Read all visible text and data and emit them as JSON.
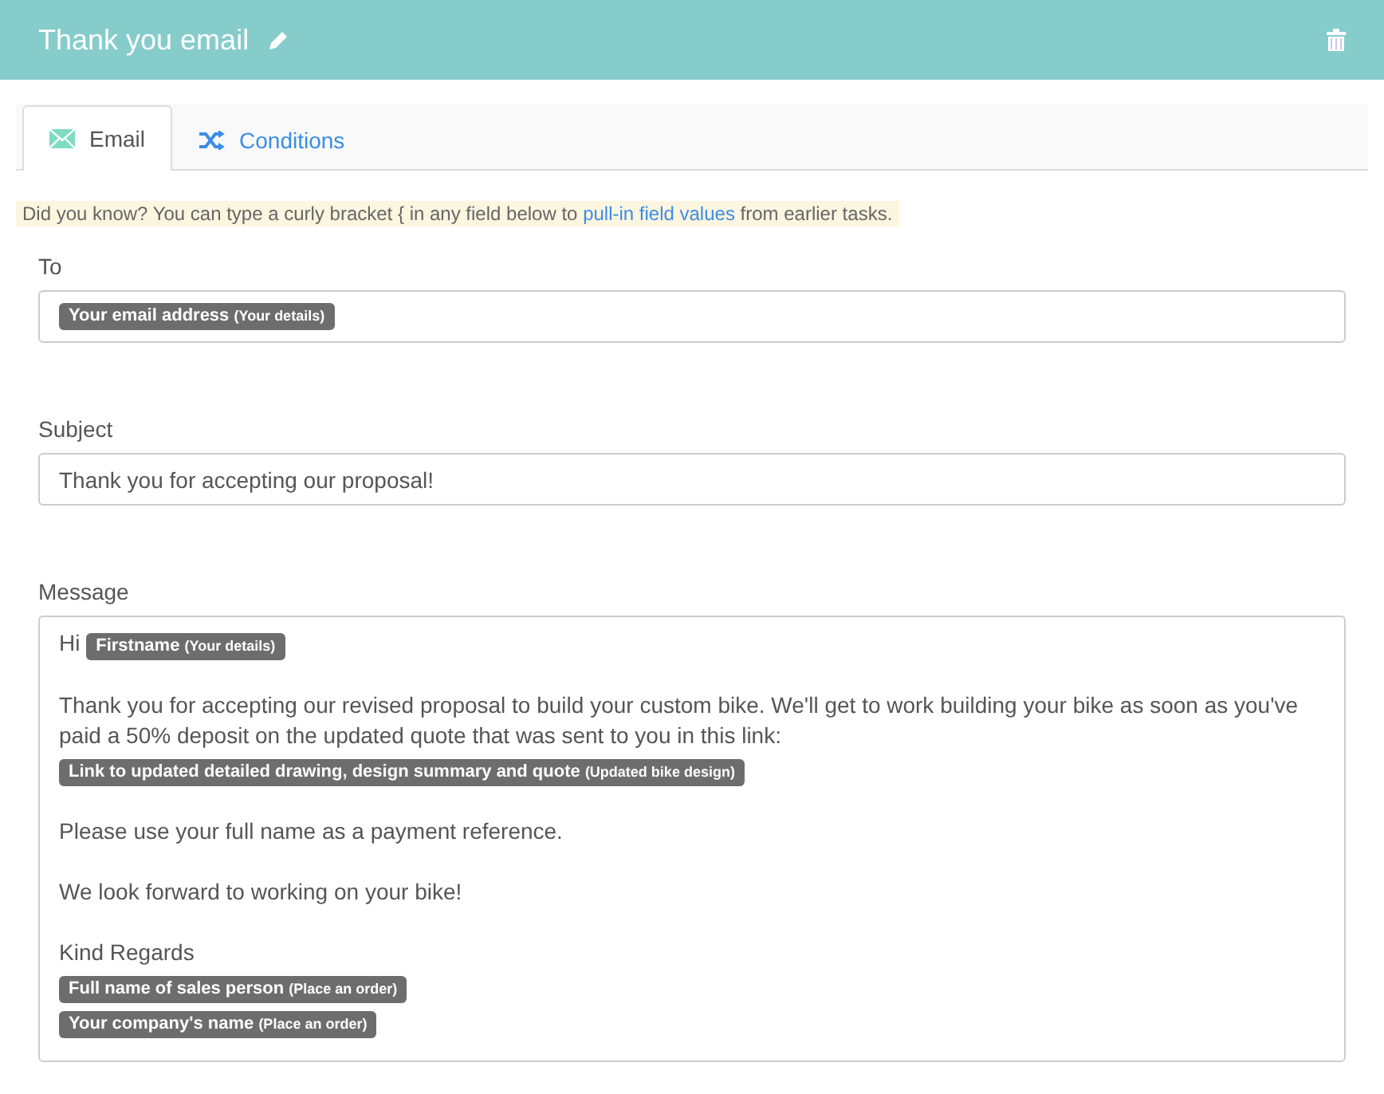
{
  "header": {
    "title": "Thank you email"
  },
  "tabs": [
    {
      "label": "Email",
      "kind": "email",
      "selected": true
    },
    {
      "label": "Conditions",
      "kind": "conditions",
      "selected": false
    }
  ],
  "tip": {
    "before": "Did you know? You can type a curly bracket { in any field below to",
    "link": "pull-in field values",
    "after": "from earlier tasks."
  },
  "to": {
    "label": "To",
    "tokens": [
      {
        "label": "Your email address",
        "source": "(Your details)"
      }
    ]
  },
  "subject": {
    "label": "Subject",
    "value": "Thank you for accepting our proposal!"
  },
  "message": {
    "label": "Message",
    "paragraphs": [
      {
        "lines": [
          {
            "parts": [
              {
                "kind": "text",
                "text": "Hi"
              },
              {
                "kind": "token",
                "label": "Firstname",
                "source": "(Your details)"
              }
            ]
          }
        ]
      },
      {
        "lines": [
          {
            "parts": [
              {
                "kind": "text",
                "text": "Thank you for accepting our revised proposal to build your custom bike. We'll get to work building your bike as soon as you've paid a 50% deposit on the updated quote that was sent to you in this link:"
              }
            ]
          },
          {
            "parts": [
              {
                "kind": "token",
                "label": "Link to updated detailed drawing, design summary and quote",
                "source": "(Updated bike design)"
              }
            ]
          }
        ]
      },
      {
        "lines": [
          {
            "parts": [
              {
                "kind": "text",
                "text": "Please use your full name as a payment reference."
              }
            ]
          }
        ]
      },
      {
        "lines": [
          {
            "parts": [
              {
                "kind": "text",
                "text": "We look forward to working on your bike!"
              }
            ]
          }
        ]
      },
      {
        "lines": [
          {
            "parts": [
              {
                "kind": "text",
                "text": "Kind Regards"
              }
            ]
          },
          {
            "parts": [
              {
                "kind": "token",
                "label": "Full name of sales person",
                "source": "(Place an order)"
              }
            ]
          },
          {
            "parts": [
              {
                "kind": "token",
                "label": "Your company's name",
                "source": "(Place an order)"
              }
            ]
          }
        ]
      }
    ]
  }
}
